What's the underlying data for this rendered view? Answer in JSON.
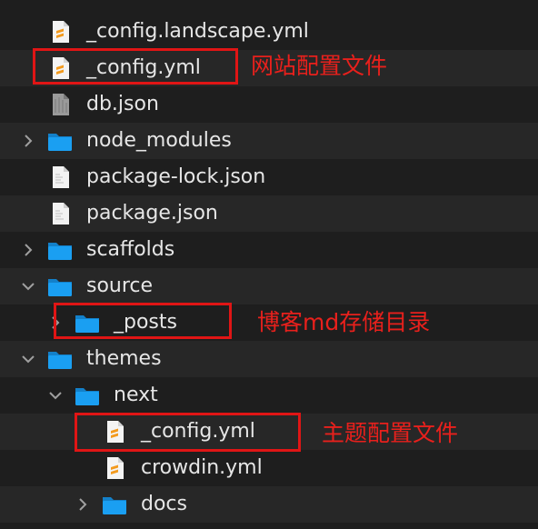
{
  "files": [
    {
      "label": "_config.landscape.yml",
      "icon": "yaml-file-icon",
      "indent": 0,
      "chevron": "none"
    },
    {
      "label": "_config.yml",
      "icon": "yaml-file-icon",
      "indent": 0,
      "chevron": "none"
    },
    {
      "label": "db.json",
      "icon": "gray-file-icon",
      "indent": 0,
      "chevron": "none"
    },
    {
      "label": "node_modules",
      "icon": "folder-icon",
      "indent": 0,
      "chevron": "collapsed"
    },
    {
      "label": "package-lock.json",
      "icon": "document-icon",
      "indent": 0,
      "chevron": "none"
    },
    {
      "label": "package.json",
      "icon": "document-icon",
      "indent": 0,
      "chevron": "none"
    },
    {
      "label": "scaffolds",
      "icon": "folder-icon",
      "indent": 0,
      "chevron": "collapsed"
    },
    {
      "label": "source",
      "icon": "folder-icon",
      "indent": 0,
      "chevron": "expanded"
    },
    {
      "label": "_posts",
      "icon": "folder-icon",
      "indent": 1,
      "chevron": "collapsed"
    },
    {
      "label": "themes",
      "icon": "folder-icon",
      "indent": 0,
      "chevron": "expanded"
    },
    {
      "label": "next",
      "icon": "folder-icon",
      "indent": 1,
      "chevron": "expanded"
    },
    {
      "label": "_config.yml",
      "icon": "yaml-file-icon",
      "indent": 2,
      "chevron": "none"
    },
    {
      "label": "crowdin.yml",
      "icon": "yaml-file-icon",
      "indent": 2,
      "chevron": "none"
    },
    {
      "label": "docs",
      "icon": "folder-icon",
      "indent": 2,
      "chevron": "collapsed"
    }
  ],
  "annotations": {
    "site_config": "网站配置文件",
    "posts_storage": "博客md存储目录",
    "theme_config": "主题配置文件"
  },
  "colors": {
    "background": "#1e1e1e",
    "alt_row": "#272727",
    "folder": "#1a9ff2",
    "annotation": "#e8201c",
    "text": "#e6e6e6"
  }
}
